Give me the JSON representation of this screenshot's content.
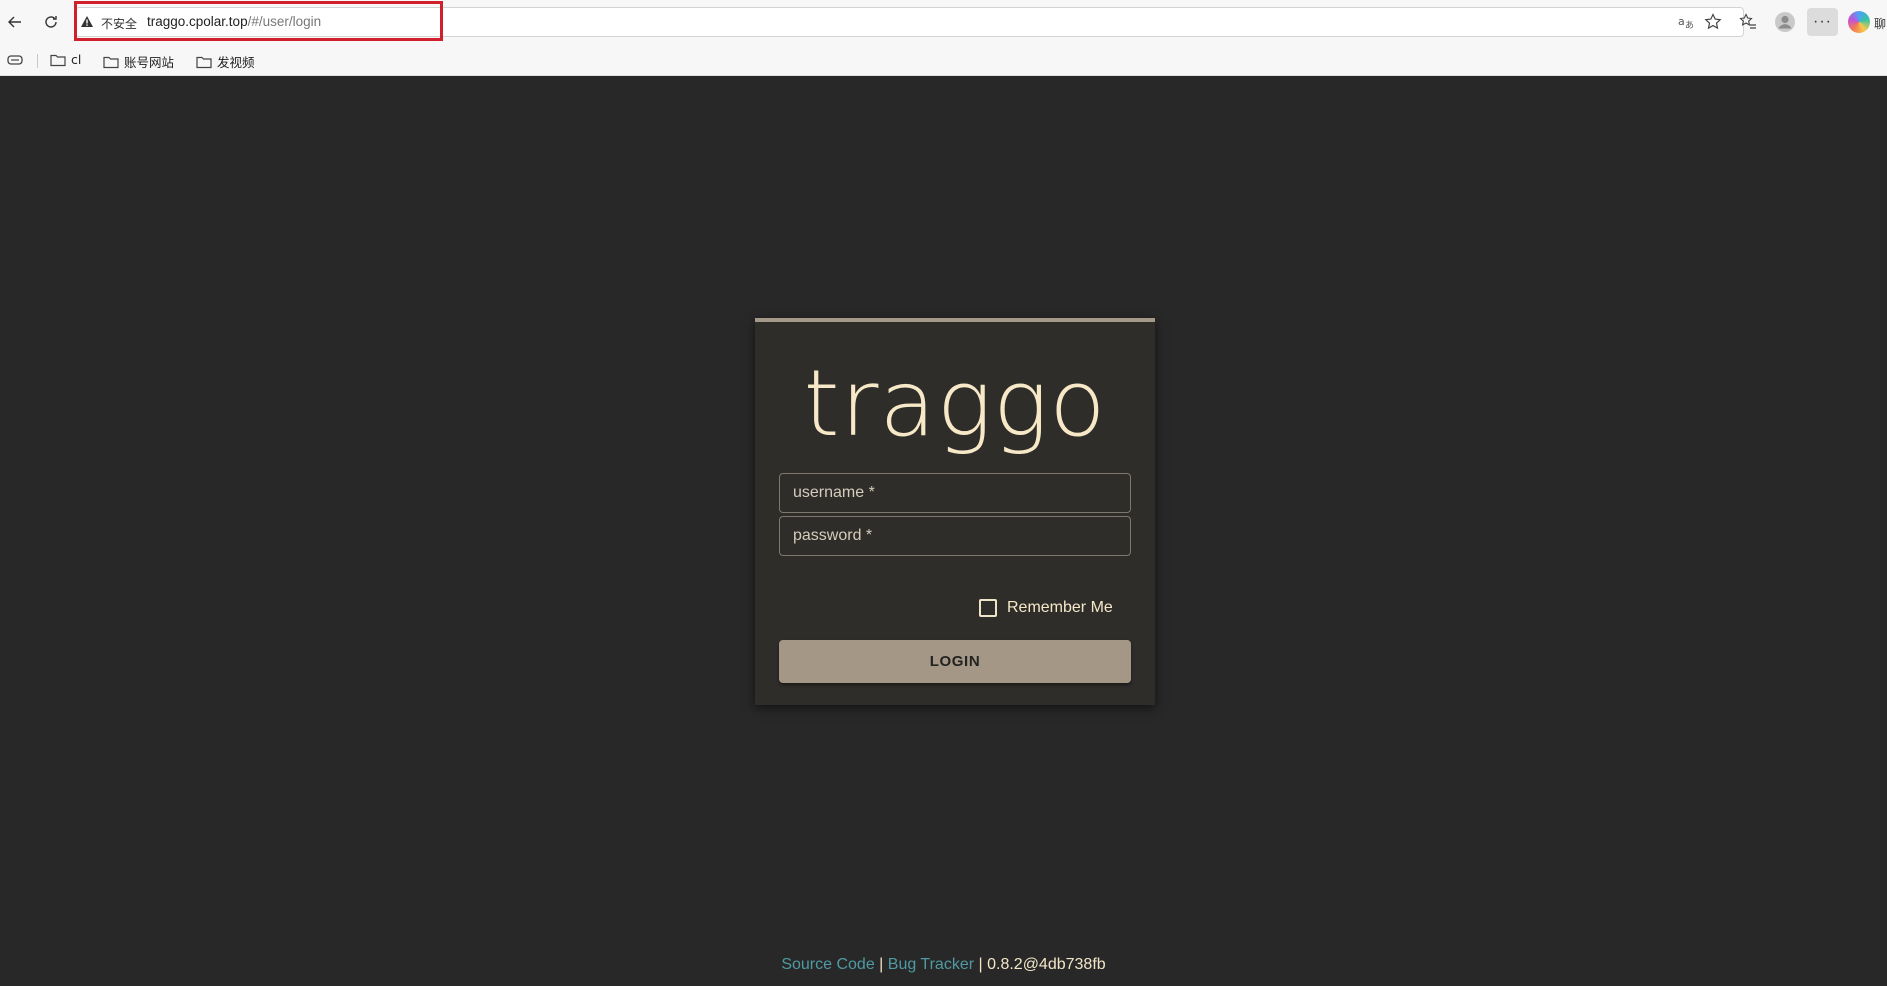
{
  "browser": {
    "security_label": "不安全",
    "url_host": "traggo.cpolar.top",
    "url_path": "/#/user/login",
    "profile_tail": "聊",
    "bookmarks": [
      {
        "label": "cl"
      },
      {
        "label": "账号网站"
      },
      {
        "label": "发视频"
      }
    ]
  },
  "login": {
    "logo": "traggo",
    "username_placeholder": "username *",
    "password_placeholder": "password *",
    "remember_label": "Remember Me",
    "remember_checked": false,
    "button_label": "LOGIN"
  },
  "footer": {
    "source_code": "Source Code",
    "sep1": "|",
    "bug_tracker": "Bug Tracker",
    "version": "| 0.8.2@4db738fb"
  },
  "colors": {
    "background": "#282828",
    "card": "#2f2d2a",
    "accent": "#a49786",
    "logo": "#f7e9c7",
    "link": "#4f9aa3",
    "highlight_box": "#d1202c"
  }
}
